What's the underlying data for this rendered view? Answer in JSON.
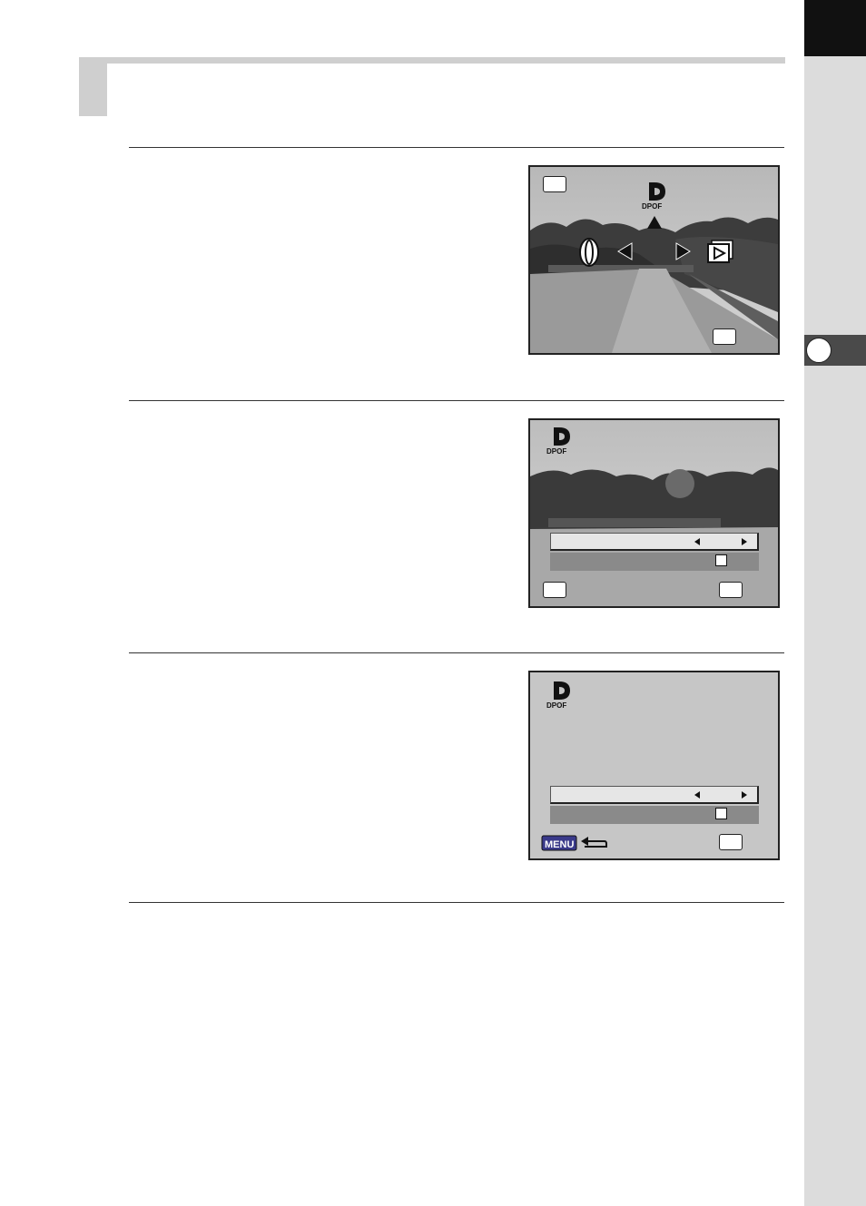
{
  "page": {
    "heading": "",
    "steps": []
  },
  "side_index": {
    "tab_icon": "chapter-circle-icon"
  },
  "screens": {
    "screen1": {
      "icons": [
        "ok-button-icon",
        "dpof-icon",
        "up-arrow-icon",
        "left-arrow-icon",
        "right-arrow-icon",
        "dial-icon",
        "playback-icon",
        "ok-button-icon"
      ],
      "dpof_label": "DPOF"
    },
    "screen2": {
      "dpof_label": "DPOF",
      "rows": [
        {
          "value": "",
          "control": "left-right-arrows"
        },
        {
          "value": "",
          "control": "checkbox"
        }
      ]
    },
    "screen3": {
      "dpof_label": "DPOF",
      "rows": [
        {
          "value": "",
          "control": "left-right-arrows"
        },
        {
          "value": "",
          "control": "checkbox"
        }
      ],
      "menu_label": "MENU"
    }
  },
  "colors": {
    "rule": "#333333",
    "side_band": "#dcdcdc",
    "side_black": "#111111",
    "heading_bar": "#cfcfcf"
  }
}
